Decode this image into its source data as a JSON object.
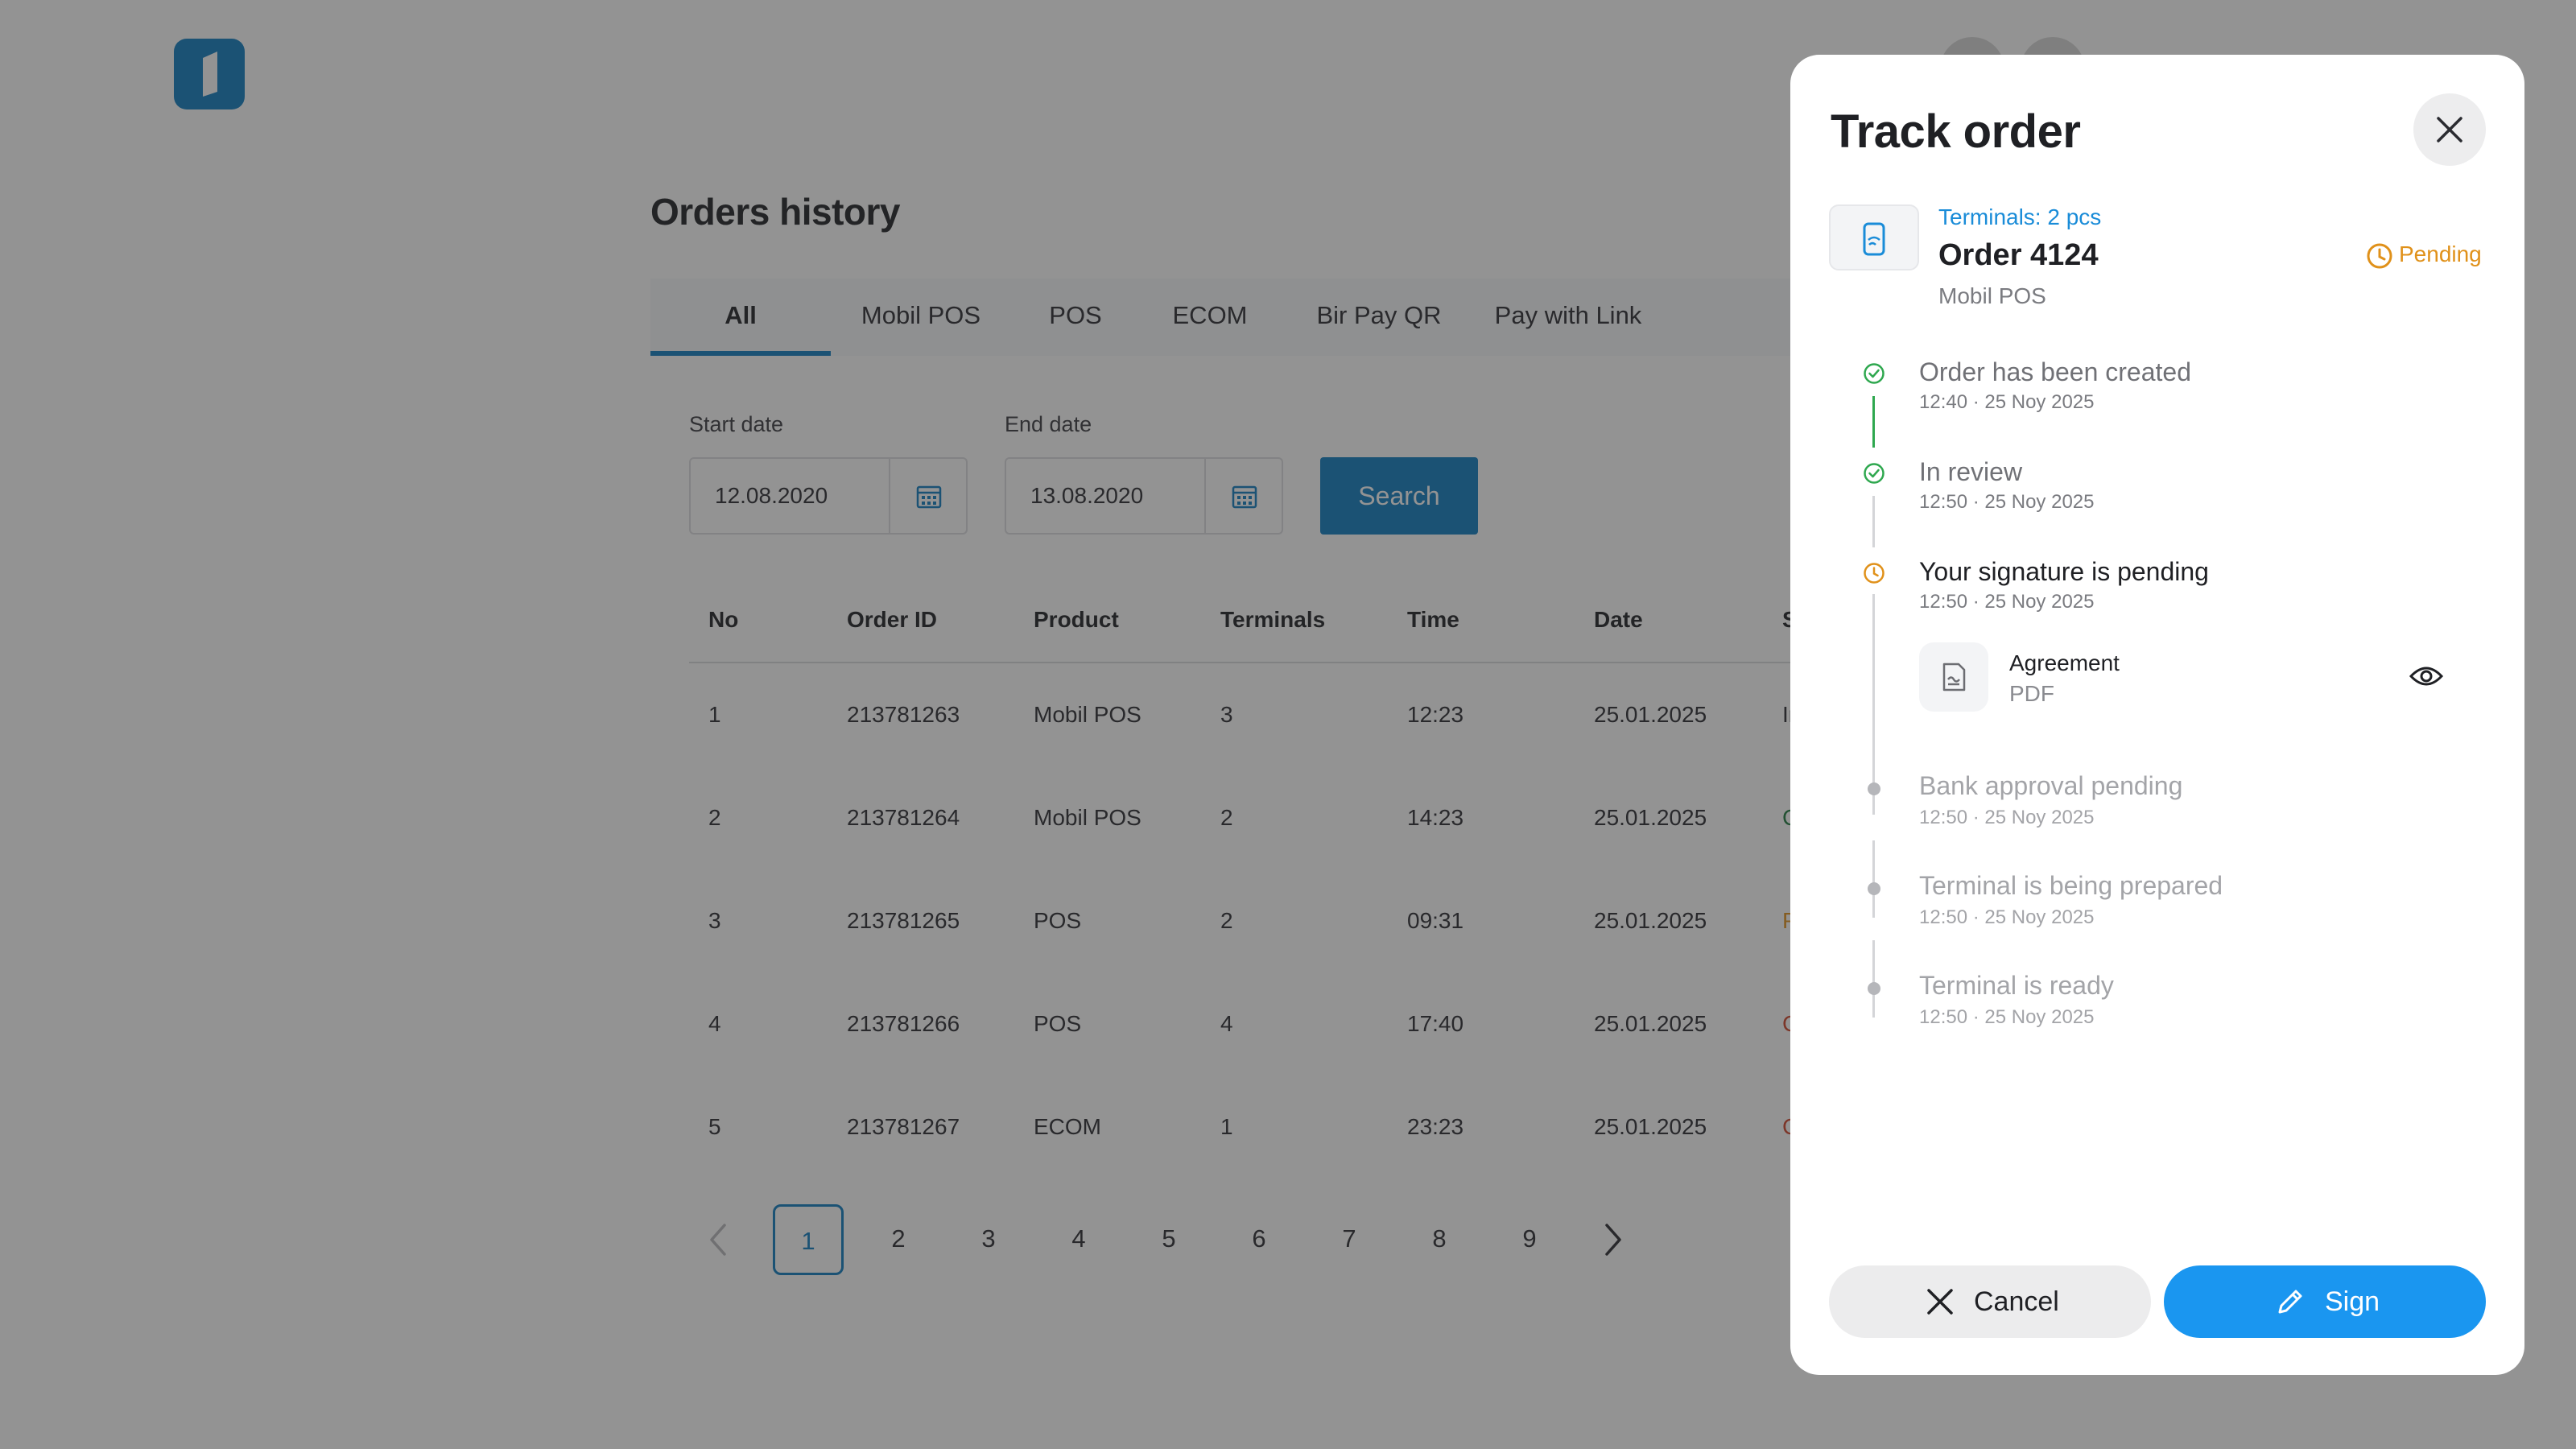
{
  "page": {
    "title": "Orders history",
    "tabs": [
      {
        "label": "All",
        "active": true
      },
      {
        "label": "Mobil POS",
        "active": false
      },
      {
        "label": "POS",
        "active": false
      },
      {
        "label": "ECOM",
        "active": false
      },
      {
        "label": "Bir Pay QR",
        "active": false
      },
      {
        "label": "Pay with Link",
        "active": false
      }
    ]
  },
  "filters": {
    "start_label": "Start date",
    "start_value": "12.08.2020",
    "end_label": "End date",
    "end_value": "13.08.2020",
    "search_label": "Search"
  },
  "table": {
    "headers": [
      "No",
      "Order ID",
      "Product",
      "Terminals",
      "Time",
      "Date",
      "S"
    ],
    "rows": [
      {
        "no": "1",
        "order_id": "213781263",
        "product": "Mobil POS",
        "terminals": "3",
        "time": "12:23",
        "date": "25.01.2025",
        "status": "Ir",
        "status_color": "#2a2b30"
      },
      {
        "no": "2",
        "order_id": "213781264",
        "product": "Mobil POS",
        "terminals": "2",
        "time": "14:23",
        "date": "25.01.2025",
        "status": "C",
        "status_color": "#1f7a3f"
      },
      {
        "no": "3",
        "order_id": "213781265",
        "product": "POS",
        "terminals": "2",
        "time": "09:31",
        "date": "25.01.2025",
        "status": "P",
        "status_color": "#e0911a"
      },
      {
        "no": "4",
        "order_id": "213781266",
        "product": "POS",
        "terminals": "4",
        "time": "17:40",
        "date": "25.01.2025",
        "status": "C",
        "status_color": "#d0452b"
      },
      {
        "no": "5",
        "order_id": "213781267",
        "product": "ECOM",
        "terminals": "1",
        "time": "23:23",
        "date": "25.01.2025",
        "status": "C",
        "status_color": "#d0452b"
      }
    ]
  },
  "pagination": {
    "pages": [
      "1",
      "2",
      "3",
      "4",
      "5",
      "6",
      "7",
      "8",
      "9"
    ],
    "current": "1"
  },
  "modal": {
    "title": "Track order",
    "order": {
      "terminals": "Terminals: 2 pcs",
      "number": "Order 4124",
      "product": "Mobil POS",
      "status": "Pending"
    },
    "timeline": [
      {
        "title": "Order has been created",
        "time": "12:40 · 25 Noy 2025",
        "state": "done"
      },
      {
        "title": "In review",
        "time": "12:50 · 25 Noy 2025",
        "state": "done"
      },
      {
        "title": "Your signature is pending",
        "time": "12:50 · 25 Noy 2025",
        "state": "current"
      },
      {
        "title": "Bank approval pending",
        "time": "12:50 · 25 Noy 2025",
        "state": "future"
      },
      {
        "title": "Terminal is being prepared",
        "time": "12:50 · 25 Noy 2025",
        "state": "future"
      },
      {
        "title": "Terminal is ready",
        "time": "12:50 · 25 Noy 2025",
        "state": "future"
      }
    ],
    "document": {
      "name": "Agreement",
      "type": "PDF"
    },
    "cancel_label": "Cancel",
    "sign_label": "Sign"
  },
  "colors": {
    "brand": "#0f7cc1",
    "accent": "#1a96f0",
    "done": "#2fa84f",
    "pending": "#e0911a"
  }
}
